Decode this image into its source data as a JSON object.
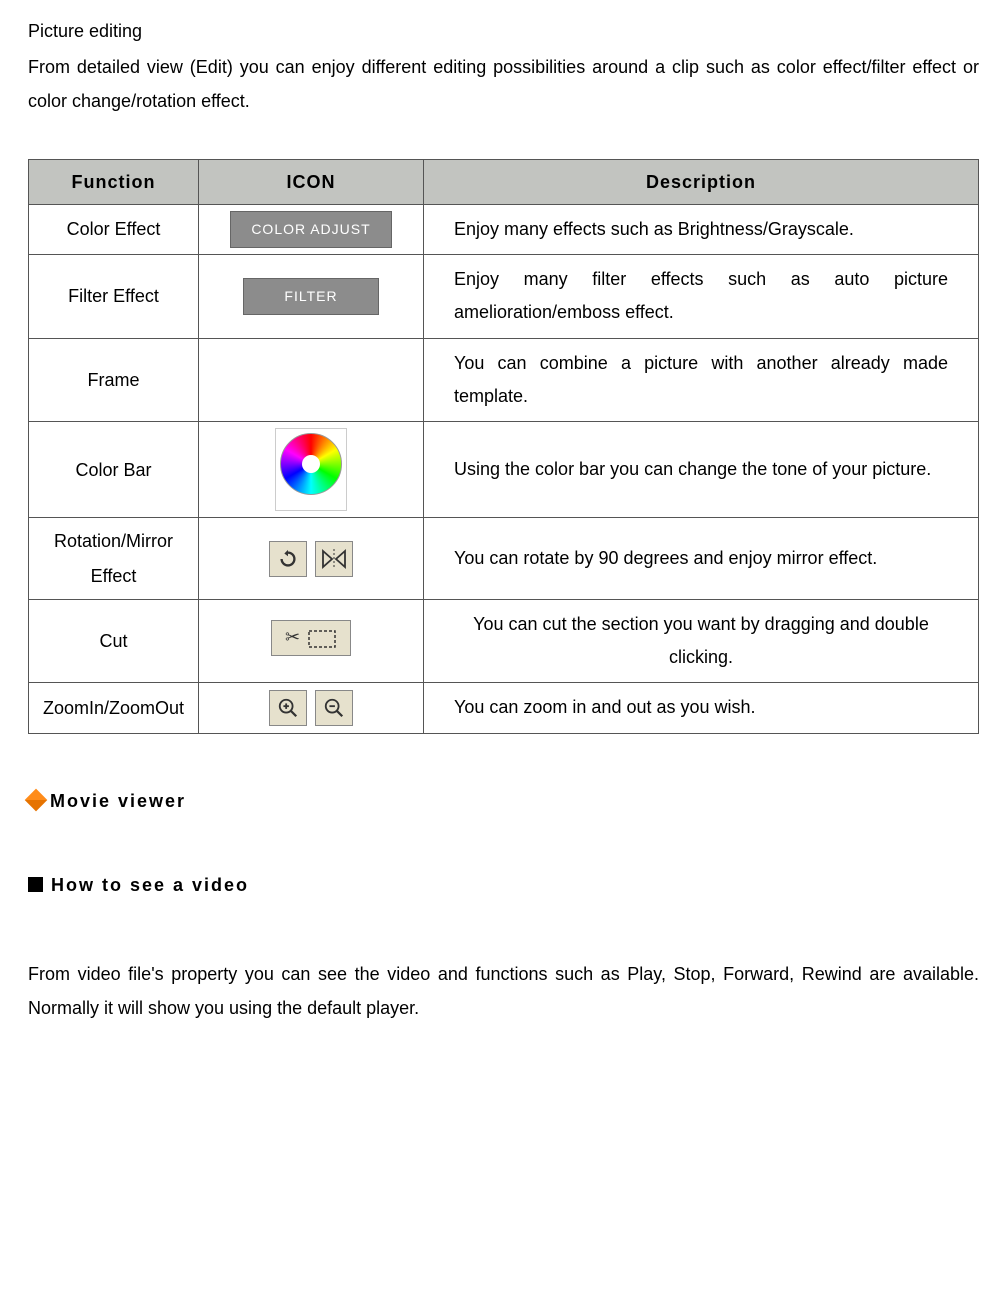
{
  "intro": {
    "title": "Picture editing",
    "text": "From detailed view (Edit) you can enjoy different editing possibilities around a clip such as color effect/filter effect or color change/rotation effect."
  },
  "table": {
    "headers": {
      "func": "Function",
      "icon": "ICON",
      "desc": "Description"
    },
    "rows": [
      {
        "func": "Color Effect",
        "iconLabel": "COLOR ADJUST",
        "desc": "Enjoy many effects such as Brightness/Grayscale."
      },
      {
        "func": "Filter Effect",
        "iconLabel": "FILTER",
        "desc": "Enjoy many filter effects such as auto picture amelioration/emboss effect."
      },
      {
        "func": "Frame",
        "desc": "You can combine a picture with another already made template."
      },
      {
        "func": "Color Bar",
        "desc": "Using the color bar you can change the tone of your picture."
      },
      {
        "func": "Rotation/Mirror Effect",
        "desc": "You can rotate by 90 degrees and enjoy mirror effect."
      },
      {
        "func": "Cut",
        "desc": "You can cut the section you want by dragging and double clicking."
      },
      {
        "func": "ZoomIn/ZoomOut",
        "desc": "You can zoom in and out as you wish."
      }
    ]
  },
  "section2": {
    "title": "Movie viewer",
    "subtitle": "How to see a video",
    "text": "From video file's property you can see the video and functions such as Play, Stop, Forward, Rewind are available. Normally it will show you using the default player."
  }
}
